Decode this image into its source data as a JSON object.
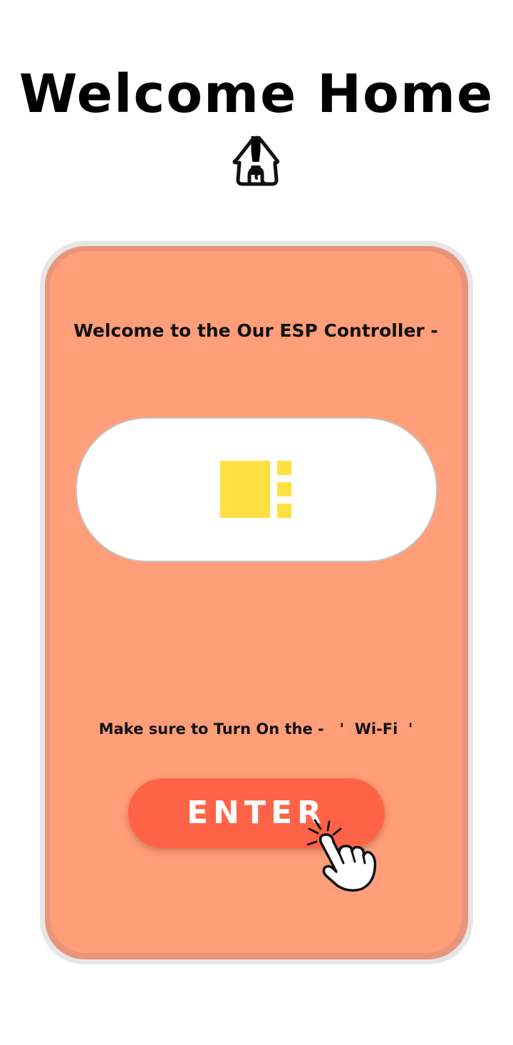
{
  "header": {
    "title": "Welcome Home !",
    "icon": "home-icon"
  },
  "card": {
    "welcome_text": "Welcome to the Our ESP Controller -",
    "toggle_icon": "chip-icon",
    "hint_text": "Make sure to Turn On the -   '  Wi-Fi  '",
    "enter_label": "ENTER",
    "pointer_icon": "hand-pointer-icon"
  },
  "colors": {
    "card_background": "#ff9e78",
    "button": "#ff6347",
    "chip": "#ffe043",
    "text": "#111111"
  }
}
